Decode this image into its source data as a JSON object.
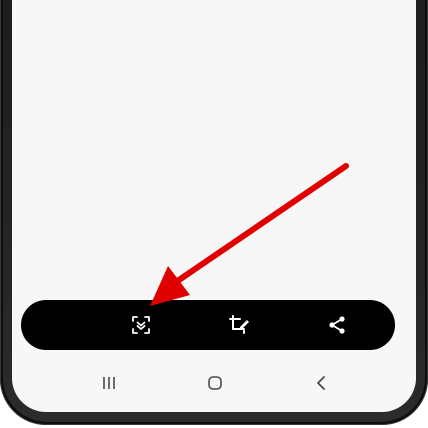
{
  "colors": {
    "screen_bg": "#f7f7f7",
    "toolbar_bg": "#000000",
    "accent": "#1f7ae0",
    "arrow": "#e00000",
    "frame": "#0d0d0d"
  },
  "toolbar": {
    "items": [
      {
        "name": "scroll-capture",
        "icon": "scroll-capture-icon"
      },
      {
        "name": "crop-edit",
        "icon": "crop-draw-icon"
      },
      {
        "name": "share",
        "icon": "share-icon"
      }
    ]
  },
  "navbar": {
    "items": [
      {
        "name": "recent-apps",
        "icon": "recents-icon"
      },
      {
        "name": "home",
        "icon": "home-icon"
      },
      {
        "name": "back",
        "icon": "back-icon"
      }
    ]
  },
  "annotation": {
    "icon": "red-arrow-icon",
    "points_to": "scroll-capture-button"
  }
}
